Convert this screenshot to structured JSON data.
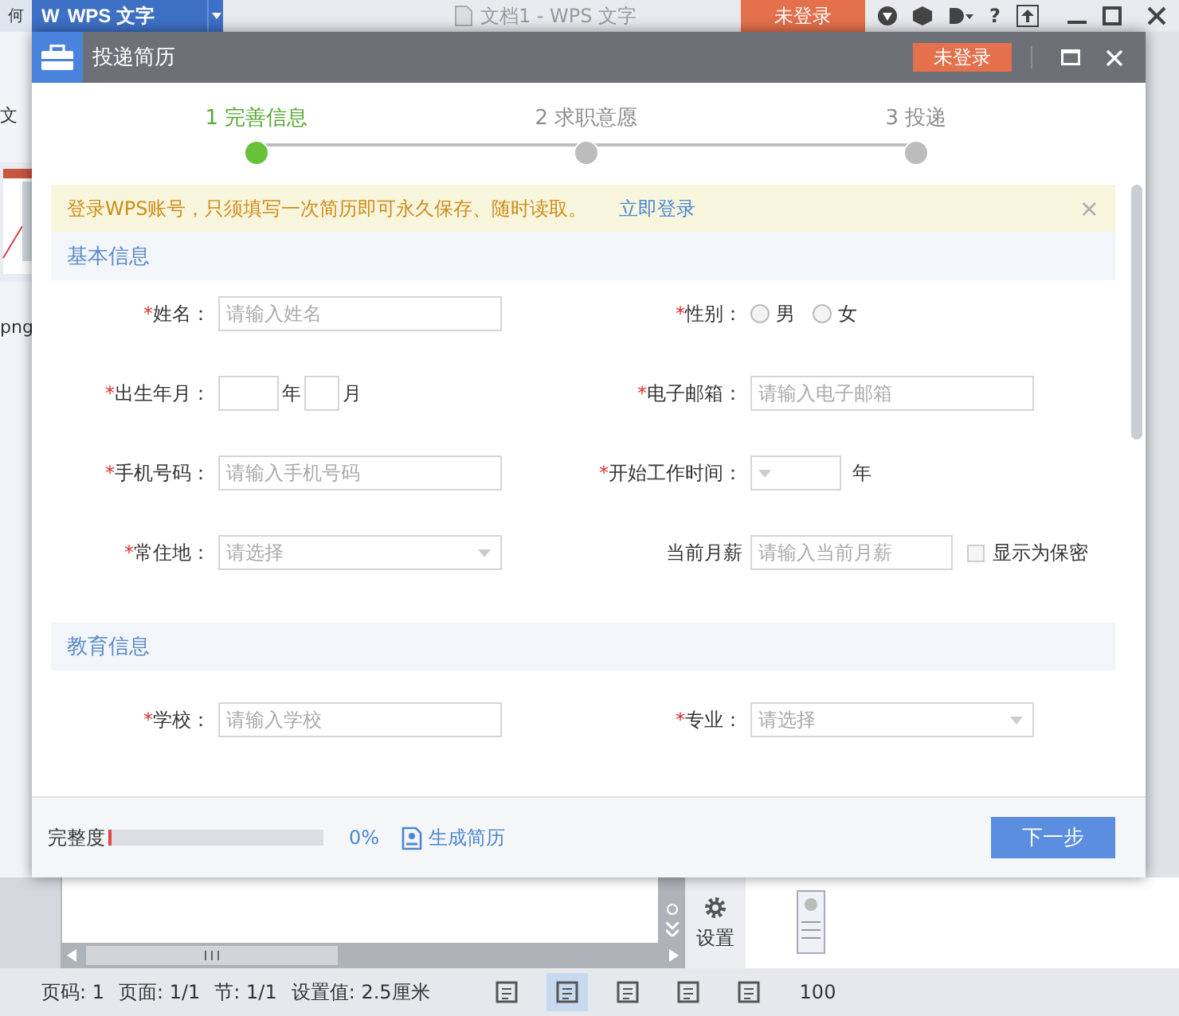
{
  "app": {
    "corner_text": "何",
    "logo": "W",
    "app_menu": "WPS 文字",
    "document_title": "文档1 - WPS 文字",
    "login_button": "未登录",
    "help": "?",
    "side_texts": [
      "文",
      "png"
    ],
    "panel_button": "设置",
    "status_bar": {
      "items": [
        "页码: 1",
        "页面: 1/1",
        "节: 1/1",
        "设置值: 2.5厘米"
      ],
      "views": [
        {
          "selected": false
        },
        {
          "selected": true
        },
        {
          "selected": false
        },
        {
          "selected": false
        },
        {
          "selected": false
        }
      ],
      "zoom": "100"
    }
  },
  "dialog": {
    "title": "投递简历",
    "login_button": "未登录",
    "steps": [
      {
        "label": "1 完善信息",
        "selected": true
      },
      {
        "label": "2 求职意愿",
        "selected": false
      },
      {
        "label": "3 投递",
        "selected": false
      }
    ],
    "notice": {
      "text": "登录WPS账号，只须填写一次简历即可永久保存、随时读取。",
      "link": "立即登录",
      "close": "×"
    },
    "sections": [
      {
        "title": "基本信息",
        "fields": [
          {
            "mark": "*",
            "label": "姓名：",
            "kind": "text",
            "placeholder": "请输入姓名"
          },
          {
            "mark": "*",
            "label": "性别：",
            "kind": "radio",
            "options": [
              {
                "label": "男",
                "selected": false
              },
              {
                "label": "女",
                "selected": false
              }
            ]
          },
          {
            "mark": "*",
            "label": "出生年月：",
            "kind": "date",
            "units": [
              "年",
              "月"
            ]
          },
          {
            "mark": "*",
            "label": "电子邮箱：",
            "kind": "text",
            "placeholder": "请输入电子邮箱"
          },
          {
            "mark": "*",
            "label": "手机号码：",
            "kind": "text",
            "placeholder": "请输入手机号码"
          },
          {
            "mark": "*",
            "label": "开始工作时间：",
            "kind": "year",
            "units": [
              "年"
            ]
          },
          {
            "mark": "*",
            "label": "常住地：",
            "kind": "select",
            "placeholder": "请选择"
          },
          {
            "label": "当前月薪",
            "kind": "text",
            "placeholder": "请输入当前月薪",
            "checkbox": {
              "label": "显示为保密",
              "checked": false
            }
          }
        ]
      },
      {
        "title": "教育信息",
        "fields": [
          {
            "mark": "*",
            "label": "学校：",
            "kind": "text",
            "placeholder": "请输入学校"
          },
          {
            "mark": "*",
            "label": "专业：",
            "kind": "select",
            "placeholder": "请选择"
          }
        ]
      }
    ],
    "footer": {
      "completeness_label": "完整度",
      "level": 0,
      "percent": "0%",
      "generate_link": "生成简历",
      "next_button": "下一步"
    }
  }
}
